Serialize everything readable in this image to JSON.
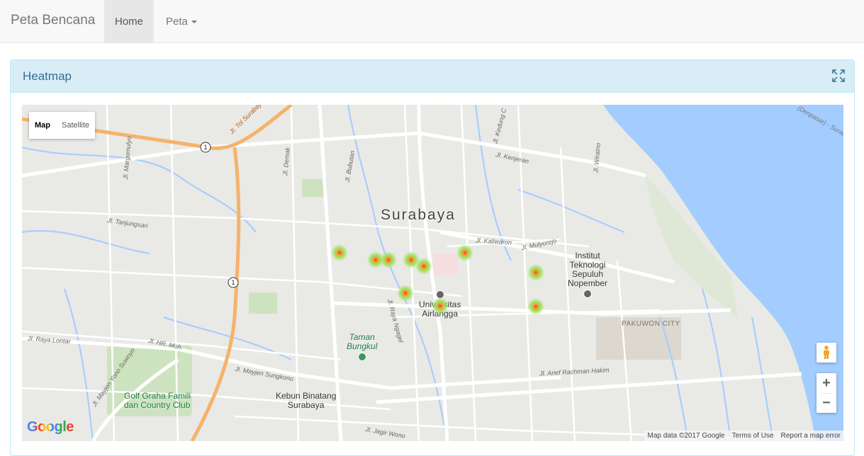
{
  "navbar": {
    "brand": "Peta Bencana",
    "items": [
      {
        "label": "Home",
        "active": true
      },
      {
        "label": "Peta",
        "dropdown": true
      }
    ]
  },
  "panel": {
    "title": "Heatmap",
    "expand_icon": "expand-icon"
  },
  "map": {
    "type_control": {
      "map": "Map",
      "satellite": "Satellite",
      "selected": "Map"
    },
    "city_label": "Surabaya",
    "poi": {
      "univ_airlangga": [
        "Universitas",
        "Airlangga"
      ],
      "its": [
        "Institut",
        "Teknologi",
        "Sepuluh",
        "Nopember"
      ],
      "taman_bungkul": [
        "Taman",
        "Bungkul"
      ],
      "kebun_binatang": [
        "Kebun Binatang",
        "Surabaya"
      ],
      "golf": [
        "Golf Graha Famili",
        "dan Country Club"
      ],
      "pakuwon": "PAKUWON CITY"
    },
    "streets": {
      "tol": "Jl. Tol Surabaya",
      "margomulyo": "Jl. Margomulyo",
      "tanjungsari": "Jl. Tanjungsari",
      "demak": "Jl. Demak",
      "bubutan": "Jl. Bubutan",
      "kedung": "Jl. Kedung C",
      "kenjeran": "Jl. Kenjeran",
      "wiratno": "Jl. Wiratno",
      "kaliwaron": "Jl. Kaliwaron",
      "mulyorejo": "Jl. Mulyorejo",
      "raya_lontar": "Jl. Raya Lontar",
      "hr_moh": "Jl. HR. Moh.",
      "yono_suwoyo": "Jl. Mayjen Yono Suwoyo",
      "sungkono": "Jl. Mayjen Sungkono",
      "raya_ngagel": "Jl. Raya Ngagel",
      "arief": "Jl. Arief Rachman Hakim",
      "jagir": "Jl. Jagir Wono",
      "bypass": "(Denpasar) - Surab"
    },
    "route_shields": [
      "1",
      "1"
    ],
    "logo": "Google",
    "attribution": [
      "Map data ©2017 Google",
      "Terms of Use",
      "Report a map error"
    ],
    "zoom_in": "+",
    "zoom_out": "−",
    "heatmap_points_count": 11,
    "colors": {
      "water": "#a3ccff",
      "land": "#e8e8e8",
      "road": "#ffffff",
      "highway": "#f6b26b",
      "heat_outer": "#9be35a",
      "heat_inner": "#e8433b"
    }
  }
}
